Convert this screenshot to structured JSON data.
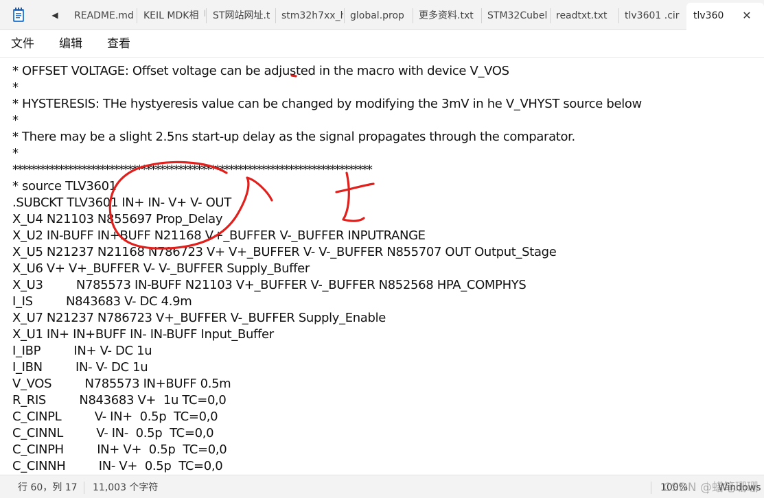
{
  "tabs": [
    {
      "label": "README.md"
    },
    {
      "label": "KEIL MDK相「"
    },
    {
      "label": "ST网站网址.t"
    },
    {
      "label": "stm32h7xx_h"
    },
    {
      "label": "global.prop"
    },
    {
      "label": "更多资料.txt"
    },
    {
      "label": "STM32Cubel"
    },
    {
      "label": "readtxt.txt"
    },
    {
      "label": "tlv3601 .cir"
    },
    {
      "label": "tlv360"
    }
  ],
  "tab_close_glyph": "✕",
  "tab_scroll_glyph": "◀",
  "menu": {
    "file": "文件",
    "edit": "编辑",
    "view": "查看"
  },
  "lines": [
    "* OFFSET VOLTAGE: Offset voltage can be adjusted in the macro with device V_VOS",
    "*",
    "* HYSTERESIS: THe hystyeresis value can be changed by modifying the 3mV in he V_VHYST source below",
    "*",
    "* There may be a slight 2.5ns start-up delay as the signal propagates through the comparator.",
    "*",
    "******************************************************************************",
    "* source TLV3601",
    ".SUBCKT TLV3601 IN+ IN- V+ V- OUT",
    "X_U4 N21103 N855697 Prop_Delay",
    "X_U2 IN-BUFF IN+BUFF N21168 V+_BUFFER V-_BUFFER INPUTRANGE",
    "X_U5 N21237 N21168 N786723 V+ V+_BUFFER V- V-_BUFFER N855707 OUT Output_Stage",
    "X_U6 V+ V+_BUFFER V- V-_BUFFER Supply_Buffer",
    "X_U3         N785573 IN-BUFF N21103 V+_BUFFER V-_BUFFER N852568 HPA_COMPHYS",
    "I_IS         N843683 V- DC 4.9m",
    "X_U7 N21237 N786723 V+_BUFFER V-_BUFFER Supply_Enable",
    "X_U1 IN+ IN+BUFF IN- IN-BUFF Input_Buffer",
    "I_IBP         IN+ V- DC 1u",
    "I_IBN         IN- V- DC 1u",
    "V_VOS         N785573 IN+BUFF 0.5m",
    "R_RIS         N843683 V+  1u TC=0,0",
    "C_CINPL         V- IN+  0.5p  TC=0,0",
    "C_CINNL         V- IN-  0.5p  TC=0,0",
    "C_CINPH         IN+ V+  0.5p  TC=0,0",
    "C_CINNH         IN- V+  0.5p  TC=0,0"
  ],
  "status": {
    "position": "行 60，列 17",
    "char_count": "11,003 个字符",
    "zoom": "100%",
    "line_ending": "Windows"
  },
  "watermark": "CSDN @蜡笔珊珊",
  "colors": {
    "annotation_red": "#e0201c",
    "tabbar_bg": "#f3f3f3",
    "active_tab_bg": "#ffffff"
  }
}
